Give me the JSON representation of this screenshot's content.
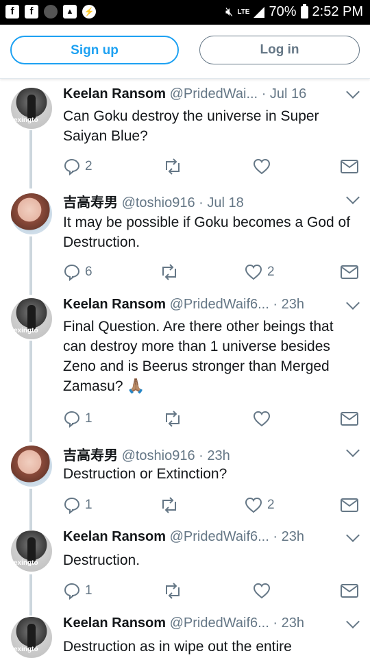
{
  "status_bar": {
    "left_icons": [
      "facebook-icon",
      "facebook-icon",
      "instagram-icon",
      "gallery-icon",
      "messenger-icon"
    ],
    "network": "LTE",
    "battery": "70%",
    "time": "2:52 PM"
  },
  "auth": {
    "signup_label": "Sign up",
    "login_label": "Log in"
  },
  "colors": {
    "accent": "#1da1f2",
    "secondary": "#657786",
    "text": "#14171a",
    "thread": "#ccd6dd"
  },
  "tweets": [
    {
      "author": "Keelan Ransom",
      "handle": "@PridedWai...",
      "time": "· Jul 16",
      "text": "Can Goku destroy the universe in Super Saiyan Blue?",
      "replies": "2",
      "retweets": "",
      "likes": ""
    },
    {
      "author": "吉高寿男",
      "handle": "@toshio916",
      "time": "· Jul 18",
      "text": "It may be possible if Goku becomes a God of Destruction.",
      "replies": "6",
      "retweets": "",
      "likes": "2"
    },
    {
      "author": "Keelan Ransom",
      "handle": "@PridedWaif6...",
      "time": "· 23h",
      "text": "Final Question. Are there other beings that can destroy more than 1 universe besides Zeno and is Beerus stronger than Merged Zamasu? 🙏🏽",
      "replies": "1",
      "retweets": "",
      "likes": ""
    },
    {
      "author": "吉高寿男",
      "handle": "@toshio916",
      "time": "· 23h",
      "text": "Destruction or Extinction?",
      "replies": "1",
      "retweets": "",
      "likes": "2"
    },
    {
      "author": "Keelan Ransom",
      "handle": "@PridedWaif6...",
      "time": "· 23h",
      "text": "Destruction.",
      "replies": "1",
      "retweets": "",
      "likes": ""
    },
    {
      "author": "Keelan Ransom",
      "handle": "@PridedWaif6...",
      "time": "· 23h",
      "text": "Destruction as in wipe out the entire",
      "replies": "",
      "retweets": "",
      "likes": ""
    }
  ]
}
